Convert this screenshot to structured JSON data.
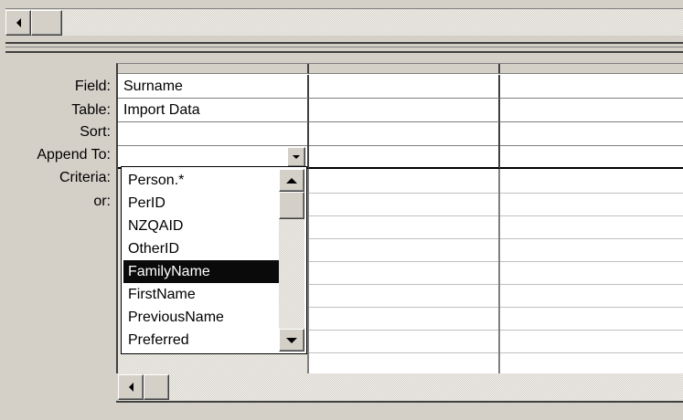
{
  "row_labels": {
    "field": "Field:",
    "table": "Table:",
    "sort": "Sort:",
    "append_to": "Append To:",
    "criteria": "Criteria:",
    "or": "or:"
  },
  "column1": {
    "field": "Surname",
    "table": "Import Data",
    "sort": "",
    "append_to": ""
  },
  "dropdown": {
    "items": [
      "Person.*",
      "PerID",
      "NZQAID",
      "OtherID",
      "FamilyName",
      "FirstName",
      "PreviousName",
      "Preferred"
    ],
    "selected": "FamilyName"
  },
  "colors": {
    "window_bg": "#d4d0c8",
    "selection_bg": "#0a0a0a",
    "selection_text": "#ffffff"
  },
  "icons": [
    "scroll-left-arrow-icon",
    "scroll-up-arrow-icon",
    "scroll-down-arrow-icon",
    "dropdown-arrow-icon"
  ]
}
